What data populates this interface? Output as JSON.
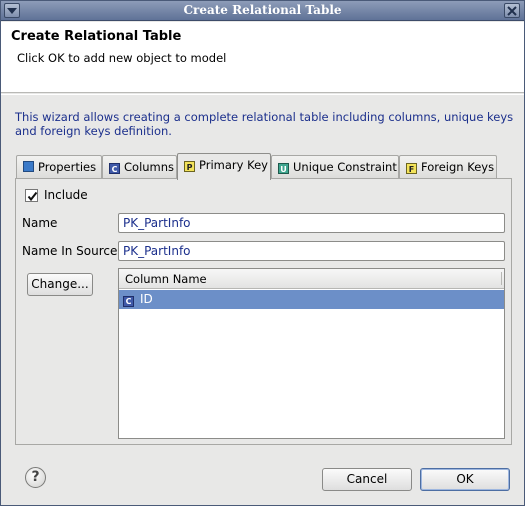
{
  "window": {
    "title": "Create Relational Table"
  },
  "header": {
    "title": "Create Relational Table",
    "description": "Click OK to add new object to model"
  },
  "wizard_description": "This wizard allows creating a complete relational table including columns, unique keys and foreign keys definition.",
  "tabs": [
    {
      "label": "Properties",
      "icon": "properties-icon",
      "icon_text": "",
      "active": false
    },
    {
      "label": "Columns",
      "icon": "columns-icon",
      "icon_text": "C",
      "active": false
    },
    {
      "label": "Primary Key",
      "icon": "primary-key-icon",
      "icon_text": "P",
      "active": true
    },
    {
      "label": "Unique Constraint",
      "icon": "unique-constraint-icon",
      "icon_text": "U",
      "active": false
    },
    {
      "label": "Foreign Keys",
      "icon": "foreign-keys-icon",
      "icon_text": "F",
      "active": false
    }
  ],
  "primary_key": {
    "include_label": "Include",
    "include_checked": true,
    "name_label": "Name",
    "name_value": "PK_PartInfo",
    "name_in_source_label": "Name In Source",
    "name_in_source_value": "PK_PartInfo",
    "change_button": "Change...",
    "table": {
      "column_header": "Column Name",
      "rows": [
        {
          "icon": "column-icon",
          "icon_text": "C",
          "name": "ID",
          "selected": true
        }
      ]
    }
  },
  "footer": {
    "cancel_button": "Cancel",
    "ok_button": "OK",
    "help_icon": "help-icon"
  },
  "colors": {
    "title_bar": "#6f82a6",
    "selection": "#6c8fc8",
    "description_text": "#1b2f8c"
  }
}
